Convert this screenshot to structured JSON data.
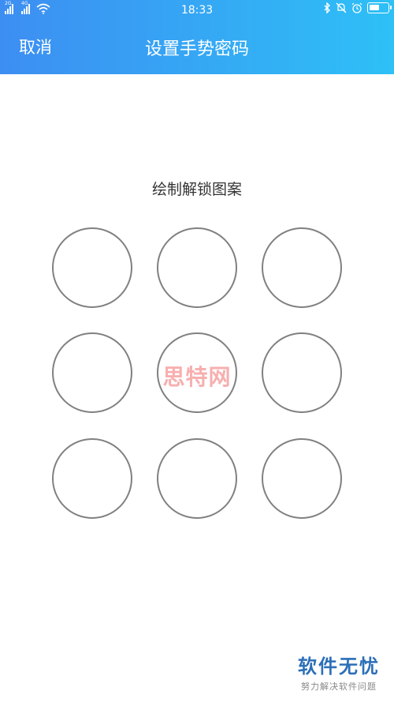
{
  "status_bar": {
    "time": "18:33",
    "network_1": "2G",
    "network_2": "4G",
    "icons": [
      "signal-icon",
      "signal-icon",
      "wifi-icon",
      "bluetooth-icon",
      "silent-icon",
      "alarm-icon",
      "battery-icon"
    ],
    "battery_level": 0.55
  },
  "header": {
    "cancel_label": "取消",
    "title": "设置手势密码",
    "gradient_start": "#3d8ef2",
    "gradient_end": "#2ec0f6"
  },
  "pattern": {
    "instruction": "绘制解锁图案",
    "node_count": 9,
    "node_color": "#808080"
  },
  "watermark": {
    "text": "思特网",
    "logo_title": "软件无忧",
    "logo_subtitle": "努力解决软件问题"
  }
}
